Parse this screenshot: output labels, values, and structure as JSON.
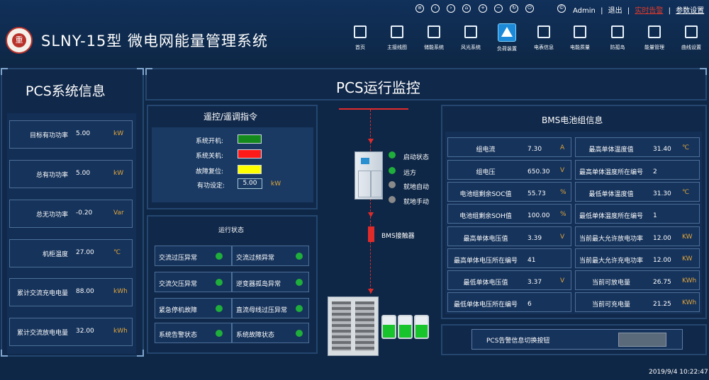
{
  "app_title": "SLNY-15型 微电网能量管理系统",
  "logo_text": "重",
  "top_bar": {
    "icons": [
      "menu-icon",
      "back-icon",
      "forward-icon",
      "home-icon",
      "zoom-in-icon",
      "zoom-out-icon",
      "refresh-icon",
      "power-icon",
      "copyright-icon"
    ],
    "user": "Admin",
    "sep": "|",
    "logout": "退出",
    "realtime_alarm": "实时告警",
    "settings": "参数设置"
  },
  "nav": [
    {
      "label": "首页",
      "icon": "home-icon"
    },
    {
      "label": "主接线图",
      "icon": "wiring-icon"
    },
    {
      "label": "储能系统",
      "icon": "storage-icon"
    },
    {
      "label": "风光系统",
      "icon": "wind-solar-icon"
    },
    {
      "label": "负荷装置",
      "icon": "load-warning-icon"
    },
    {
      "label": "电表信息",
      "icon": "meter-icon"
    },
    {
      "label": "电能质量",
      "icon": "power-quality-icon"
    },
    {
      "label": "防孤岛",
      "icon": "anti-island-icon"
    },
    {
      "label": "能量管理",
      "icon": "energy-manager-icon"
    },
    {
      "label": "曲线设置",
      "icon": "curve-icon"
    }
  ],
  "pcs_info": {
    "title": "PCS系统信息",
    "rows": [
      {
        "label": "目标有功功率",
        "value": "5.00",
        "unit": "kW"
      },
      {
        "label": "总有功功率",
        "value": "5.00",
        "unit": "kW"
      },
      {
        "label": "总无功功率",
        "value": "-0.20",
        "unit": "Var"
      },
      {
        "label": "机柜温度",
        "value": "27.00",
        "unit": "℃"
      },
      {
        "label": "累计交流充电电量",
        "value": "88.00",
        "unit": "kWh"
      },
      {
        "label": "累计交流放电电量",
        "value": "32.00",
        "unit": "kWh"
      }
    ]
  },
  "pcs_monitor": {
    "title": "PCS运行监控"
  },
  "remote_control": {
    "title": "遥控/遥调指令",
    "rows": [
      {
        "label": "系统开机:",
        "color": "#138a1b"
      },
      {
        "label": "系统关机:",
        "color": "#ff1a1a"
      },
      {
        "label": "故障复位:",
        "color": "#ffff00"
      }
    ],
    "power_label": "有功设定:",
    "power_value": "5.00",
    "power_unit": "kW"
  },
  "run_status": {
    "title": "运行状态",
    "items": [
      {
        "label": "交流过压异常"
      },
      {
        "label": "交流过频异常"
      },
      {
        "label": "交流欠压异常"
      },
      {
        "label": "逆变器孤岛异常"
      },
      {
        "label": "紧急停机故障"
      },
      {
        "label": "直流母线过压异常"
      },
      {
        "label": "系统告警状态"
      },
      {
        "label": "系统故障状态"
      }
    ]
  },
  "device_status": [
    {
      "label": "启动状态",
      "color": "#1fae3b"
    },
    {
      "label": "远方",
      "color": "#1fae3b"
    },
    {
      "label": "就地自动",
      "color": "#8a8a8a"
    },
    {
      "label": "就地手动",
      "color": "#8a8a8a"
    }
  ],
  "bms_contactor": "BMS接触器",
  "bms": {
    "title": "BMS电池组信息",
    "left": [
      {
        "label": "组电流",
        "value": "7.30",
        "unit": "A"
      },
      {
        "label": "组电压",
        "value": "650.30",
        "unit": "V"
      },
      {
        "label": "电池组剩余SOC值",
        "value": "55.73",
        "unit": "%"
      },
      {
        "label": "电池组剩余SOH值",
        "value": "100.00",
        "unit": "%"
      },
      {
        "label": "最高单体电压值",
        "value": "3.39",
        "unit": "V"
      },
      {
        "label": "最高单体电压所在编号",
        "value": "41",
        "unit": ""
      },
      {
        "label": "最低单体电压值",
        "value": "3.37",
        "unit": "V"
      },
      {
        "label": "最低单体电压所在编号",
        "value": "6",
        "unit": ""
      }
    ],
    "right": [
      {
        "label": "最高单体温度值",
        "value": "31.40",
        "unit": "℃"
      },
      {
        "label": "最高单体温度所在编号",
        "value": "2",
        "unit": ""
      },
      {
        "label": "最低单体温度值",
        "value": "31.30",
        "unit": "℃"
      },
      {
        "label": "最低单体温度所在编号",
        "value": "1",
        "unit": ""
      },
      {
        "label": "当前最大允许放电功率",
        "value": "12.00",
        "unit": "KW"
      },
      {
        "label": "当前最大允许充电功率",
        "value": "12.00",
        "unit": "KW"
      },
      {
        "label": "当前可放电量",
        "value": "26.75",
        "unit": "KWh"
      },
      {
        "label": "当前可充电量",
        "value": "21.25",
        "unit": "KWh"
      }
    ]
  },
  "pcs_alarm_toggle": "PCS告警信息切换按钮",
  "datetime": "2019/9/4 10:22:47"
}
